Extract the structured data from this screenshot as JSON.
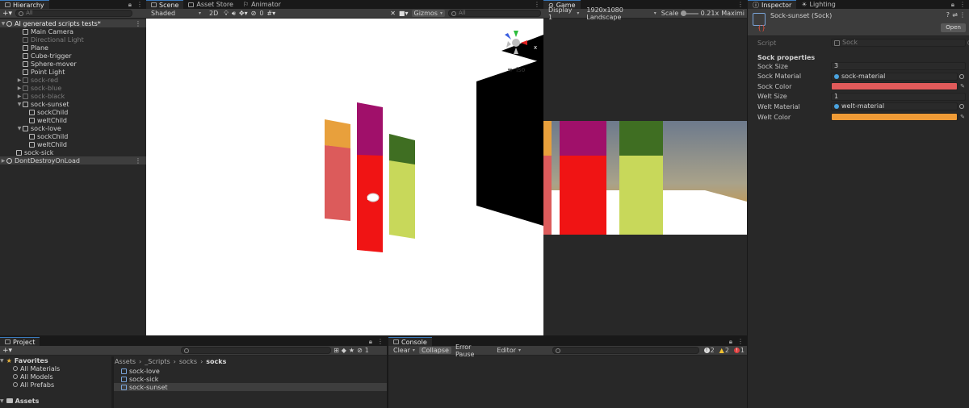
{
  "hierarchy": {
    "tab": "Hierarchy",
    "search_placeholder": "All",
    "scene_name": "AI generated scripts tests*",
    "items": [
      {
        "label": "Main Camera",
        "dim": false
      },
      {
        "label": "Directional Light",
        "dim": true
      },
      {
        "label": "Plane",
        "dim": false
      },
      {
        "label": "Cube-trigger",
        "dim": false
      },
      {
        "label": "Sphere-mover",
        "dim": false
      },
      {
        "label": "Point Light",
        "dim": false
      },
      {
        "label": "sock-red",
        "dim": true
      },
      {
        "label": "sock-blue",
        "dim": true
      },
      {
        "label": "sock-black",
        "dim": true
      },
      {
        "label": "sock-sunset",
        "dim": false
      },
      {
        "label": "sockChild",
        "dim": false
      },
      {
        "label": "weltChild",
        "dim": false
      },
      {
        "label": "sock-love",
        "dim": false
      },
      {
        "label": "sockChild",
        "dim": false
      },
      {
        "label": "weltChild",
        "dim": false
      },
      {
        "label": "sock-sick",
        "dim": false
      }
    ],
    "dont_destroy": "DontDestroyOnLoad"
  },
  "scene": {
    "tabs": [
      "Scene",
      "Asset Store",
      "Animator"
    ],
    "shading": "Shaded",
    "mode_2d": "2D",
    "gizmos": "Gizmos",
    "search_placeholder": "All",
    "layers_count": "0",
    "iso_label": "Iso",
    "axis_x": "x"
  },
  "game": {
    "tab": "Game",
    "display": "Display 1",
    "resolution": "1920x1080 Landscape",
    "scale_label": "Scale",
    "scale_value": "0.21x",
    "maximize": "Maximi"
  },
  "inspector": {
    "tabs": [
      "Inspector",
      "Lighting"
    ],
    "object_name": "Sock-sunset (Sock)",
    "open_button": "Open",
    "script_label": "Script",
    "script_value": "Sock",
    "section": "Sock properties",
    "fields": [
      {
        "label": "Sock Size",
        "value": "3",
        "kind": "text"
      },
      {
        "label": "Sock Material",
        "value": "sock-material",
        "kind": "object"
      },
      {
        "label": "Sock Color",
        "value": "",
        "kind": "color",
        "color": "#e05a5a"
      },
      {
        "label": "Welt Size",
        "value": "1",
        "kind": "text"
      },
      {
        "label": "Welt Material",
        "value": "welt-material",
        "kind": "object"
      },
      {
        "label": "Welt Color",
        "value": "",
        "kind": "color",
        "color": "#ef9b36"
      }
    ]
  },
  "project": {
    "tab": "Project",
    "favorites_label": "Favorites",
    "favorites": [
      "All Materials",
      "All Models",
      "All Prefabs"
    ],
    "assets_label": "Assets",
    "breadcrumb": [
      "Assets",
      "_Scripts",
      "socks",
      "socks"
    ],
    "files": [
      "sock-love",
      "sock-sick",
      "sock-sunset"
    ],
    "hidden_count": "1"
  },
  "console": {
    "tab": "Console",
    "clear": "Clear",
    "collapse": "Collapse",
    "error_pause": "Error Pause",
    "editor": "Editor",
    "log_count": "2",
    "warn_count": "2",
    "error_count": "1"
  },
  "colors": {
    "accent": "#3a79bb",
    "sock_red": "#f01414",
    "sock_magenta": "#a0106a",
    "sock_salmon": "#dc5b5b",
    "sock_orange": "#e8a03c",
    "sock_lime": "#c8d85a",
    "sock_green": "#3f6e22"
  }
}
